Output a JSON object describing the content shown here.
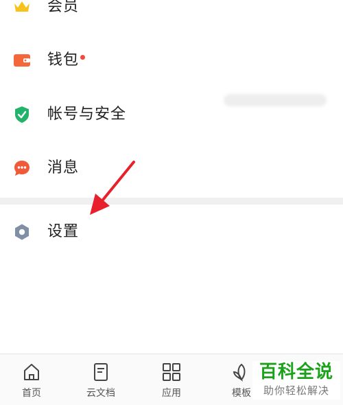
{
  "menu": {
    "items": [
      {
        "label": "会员",
        "icon": "crown-icon"
      },
      {
        "label": "钱包",
        "icon": "wallet-icon",
        "has_badge": true
      },
      {
        "label": "帐号与安全",
        "icon": "shield-check-icon"
      },
      {
        "label": "消息",
        "icon": "chat-bubble-icon"
      },
      {
        "label": "设置",
        "icon": "hexagon-settings-icon"
      }
    ]
  },
  "tabbar": {
    "tabs": [
      {
        "label": "首页",
        "icon": "home-icon"
      },
      {
        "label": "云文档",
        "icon": "document-icon"
      },
      {
        "label": "应用",
        "icon": "grid-apps-icon"
      },
      {
        "label": "模板",
        "icon": "leaf-icon"
      }
    ]
  },
  "watermark": {
    "main": "百科全说",
    "sub": "助你轻松解决"
  },
  "colors": {
    "crown": "#f7c21b",
    "wallet": "#f4673a",
    "shield": "#21b36a",
    "chat": "#f05a38",
    "settings": "#7f8fa6",
    "badge": "#f24a3b",
    "arrow": "#e8202b",
    "watermark": "#1aa21a"
  }
}
